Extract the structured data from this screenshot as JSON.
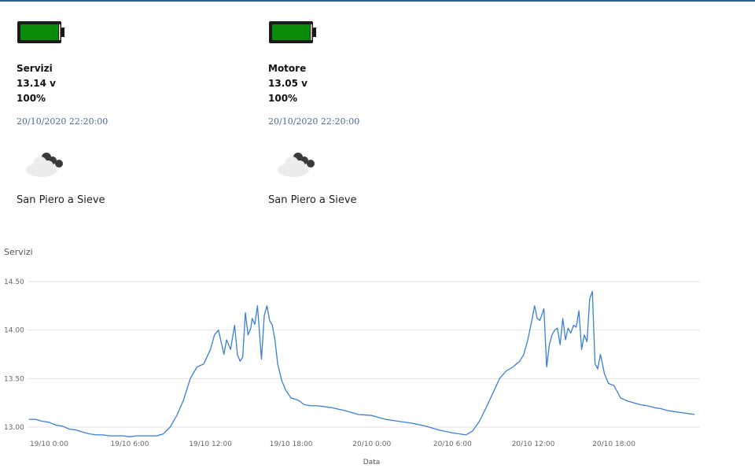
{
  "cards": [
    {
      "name": "Servizi",
      "voltage": "13.14 v",
      "percent": "100%",
      "timestamp": "20/10/2020 22:20:00",
      "location": "San Piero a Sieve",
      "battery_color": "#0a8a0a",
      "weather_icon": "cloud-night-icon"
    },
    {
      "name": "Motore",
      "voltage": "13.05 v",
      "percent": "100%",
      "timestamp": "20/10/2020 22:20:00",
      "location": "San Piero a Sieve",
      "battery_color": "#0a8a0a",
      "weather_icon": "cloud-night-icon"
    }
  ],
  "chart_data": {
    "type": "line",
    "title": "Servizi",
    "xlabel": "Data",
    "ylabel": "",
    "ylim": [
      13.0,
      14.5
    ],
    "yticks": [
      13.0,
      13.5,
      14.0,
      14.5
    ],
    "ytick_labels": [
      "13.00",
      "13.50",
      "14.00",
      "14.50"
    ],
    "xlim": [
      -1.6,
      48.4
    ],
    "xticks": [
      0,
      6,
      12,
      18,
      24,
      30,
      36,
      42
    ],
    "xtick_labels": [
      "19/10 0:00",
      "19/10 6:00",
      "19/10 12:00",
      "19/10 18:00",
      "20/10 0:00",
      "20/10 6:00",
      "20/10 12:00",
      "20/10 18:00"
    ],
    "grid": "horizontal",
    "color": "#3a7fd5",
    "series": [
      {
        "name": "",
        "x": [
          -1.5,
          -1.0,
          -0.5,
          0.0,
          0.5,
          1.0,
          1.5,
          2.0,
          2.5,
          3.0,
          3.5,
          4.0,
          4.5,
          5.0,
          5.5,
          6.0,
          6.5,
          7.0,
          7.5,
          8.0,
          8.5,
          9.0,
          9.5,
          10.0,
          10.5,
          11.0,
          11.5,
          12.0,
          12.3,
          12.6,
          13.0,
          13.2,
          13.5,
          13.8,
          14.0,
          14.2,
          14.4,
          14.6,
          14.8,
          15.0,
          15.1,
          15.3,
          15.5,
          15.8,
          16.0,
          16.2,
          16.4,
          16.6,
          16.8,
          17.0,
          17.3,
          17.6,
          18.0,
          18.5,
          19.0,
          19.5,
          20.0,
          21.0,
          22.0,
          23.0,
          24.0,
          25.0,
          26.0,
          27.0,
          28.0,
          29.0,
          30.0,
          30.5,
          31.0,
          31.5,
          32.0,
          32.5,
          33.0,
          33.5,
          34.0,
          34.5,
          35.0,
          35.3,
          35.6,
          35.9,
          36.1,
          36.3,
          36.5,
          36.8,
          37.0,
          37.2,
          37.4,
          37.6,
          37.8,
          38.0,
          38.2,
          38.4,
          38.6,
          38.8,
          39.0,
          39.2,
          39.4,
          39.6,
          39.8,
          40.0,
          40.2,
          40.4,
          40.6,
          40.8,
          41.0,
          41.3,
          41.6,
          42.0,
          42.5,
          43.0,
          43.5,
          44.0,
          44.5,
          45.0,
          45.5,
          46.0,
          46.5,
          47.0,
          47.5,
          48.0
        ],
        "y": [
          13.08,
          13.08,
          13.06,
          13.05,
          13.02,
          13.01,
          12.98,
          12.97,
          12.95,
          12.93,
          12.92,
          12.92,
          12.91,
          12.91,
          12.91,
          12.9,
          12.91,
          12.91,
          12.91,
          12.91,
          12.93,
          13.0,
          13.12,
          13.28,
          13.5,
          13.62,
          13.65,
          13.8,
          13.95,
          14.0,
          13.75,
          13.9,
          13.8,
          14.05,
          13.75,
          13.68,
          13.72,
          14.18,
          13.95,
          14.02,
          14.12,
          14.06,
          14.25,
          13.7,
          14.15,
          14.25,
          14.1,
          14.05,
          13.9,
          13.65,
          13.48,
          13.38,
          13.3,
          13.28,
          13.23,
          13.22,
          13.22,
          13.2,
          13.17,
          13.13,
          13.12,
          13.08,
          13.06,
          13.04,
          13.01,
          12.97,
          12.94,
          12.93,
          12.92,
          12.96,
          13.06,
          13.2,
          13.35,
          13.5,
          13.58,
          13.62,
          13.68,
          13.75,
          13.9,
          14.1,
          14.25,
          14.12,
          14.1,
          14.22,
          13.62,
          13.85,
          13.95,
          14.0,
          14.02,
          13.85,
          14.12,
          13.9,
          14.02,
          13.97,
          14.05,
          14.03,
          14.2,
          13.8,
          13.95,
          13.88,
          14.32,
          14.4,
          13.65,
          13.6,
          13.75,
          13.55,
          13.45,
          13.43,
          13.3,
          13.27,
          13.25,
          13.23,
          13.22,
          13.2,
          13.19,
          13.17,
          13.16,
          13.15,
          13.14,
          13.13
        ]
      }
    ]
  }
}
